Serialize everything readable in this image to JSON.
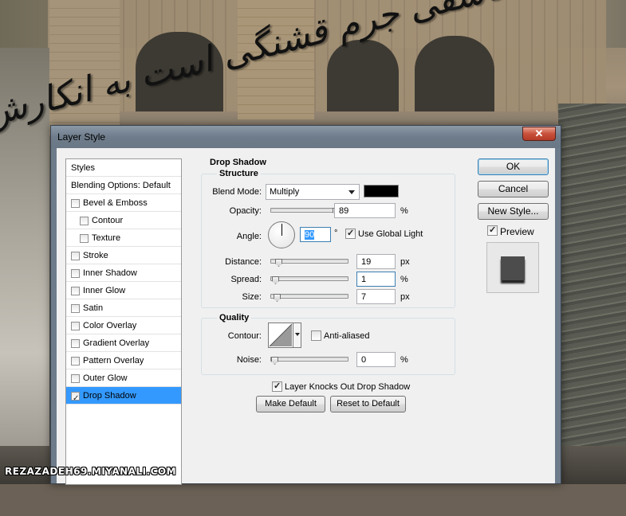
{
  "background": {
    "calligraphy_text": "عاشقی جرم قشنگی است به انکارش کوش",
    "watermark": "REZAZADEH69.MIYANALI.COM"
  },
  "dialog": {
    "title": "Layer Style",
    "close_symbol": "✕",
    "styles_list": [
      {
        "label": "Styles",
        "checkbox": false,
        "checked": false,
        "indent": 0,
        "selected": false
      },
      {
        "label": "Blending Options: Default",
        "checkbox": false,
        "checked": false,
        "indent": 0,
        "selected": false
      },
      {
        "label": "Bevel & Emboss",
        "checkbox": true,
        "checked": false,
        "indent": 0,
        "selected": false
      },
      {
        "label": "Contour",
        "checkbox": true,
        "checked": false,
        "indent": 1,
        "selected": false
      },
      {
        "label": "Texture",
        "checkbox": true,
        "checked": false,
        "indent": 1,
        "selected": false
      },
      {
        "label": "Stroke",
        "checkbox": true,
        "checked": false,
        "indent": 0,
        "selected": false
      },
      {
        "label": "Inner Shadow",
        "checkbox": true,
        "checked": false,
        "indent": 0,
        "selected": false
      },
      {
        "label": "Inner Glow",
        "checkbox": true,
        "checked": false,
        "indent": 0,
        "selected": false
      },
      {
        "label": "Satin",
        "checkbox": true,
        "checked": false,
        "indent": 0,
        "selected": false
      },
      {
        "label": "Color Overlay",
        "checkbox": true,
        "checked": false,
        "indent": 0,
        "selected": false
      },
      {
        "label": "Gradient Overlay",
        "checkbox": true,
        "checked": false,
        "indent": 0,
        "selected": false
      },
      {
        "label": "Pattern Overlay",
        "checkbox": true,
        "checked": false,
        "indent": 0,
        "selected": false
      },
      {
        "label": "Outer Glow",
        "checkbox": true,
        "checked": false,
        "indent": 0,
        "selected": false
      },
      {
        "label": "Drop Shadow",
        "checkbox": true,
        "checked": true,
        "indent": 0,
        "selected": true
      }
    ],
    "drop_shadow": {
      "section_title": "Drop Shadow",
      "structure": {
        "legend": "Structure",
        "blend_mode_label": "Blend Mode:",
        "blend_mode_value": "Multiply",
        "shadow_color": "#000000",
        "opacity_label": "Opacity:",
        "opacity_value": "89",
        "opacity_fraction": 0.89,
        "opacity_unit": "%",
        "angle_label": "Angle:",
        "angle_value": "90",
        "angle_unit": "°",
        "use_global_light_label": "Use Global Light",
        "use_global_light": true,
        "distance_label": "Distance:",
        "distance_value": "19",
        "distance_fraction": 0.06,
        "distance_unit": "px",
        "spread_label": "Spread:",
        "spread_value": "1",
        "spread_fraction": 0.01,
        "spread_unit": "%",
        "size_label": "Size:",
        "size_value": "7",
        "size_fraction": 0.03,
        "size_unit": "px"
      },
      "quality": {
        "legend": "Quality",
        "contour_label": "Contour:",
        "anti_aliased_label": "Anti-aliased",
        "anti_aliased": false,
        "noise_label": "Noise:",
        "noise_value": "0",
        "noise_fraction": 0.0,
        "noise_unit": "%"
      },
      "knockout_label": "Layer Knocks Out Drop Shadow",
      "knockout": true,
      "make_default_label": "Make Default",
      "reset_default_label": "Reset to Default"
    },
    "buttons": {
      "ok": "OK",
      "cancel": "Cancel",
      "new_style": "New Style...",
      "preview_label": "Preview",
      "preview_checked": true
    }
  }
}
